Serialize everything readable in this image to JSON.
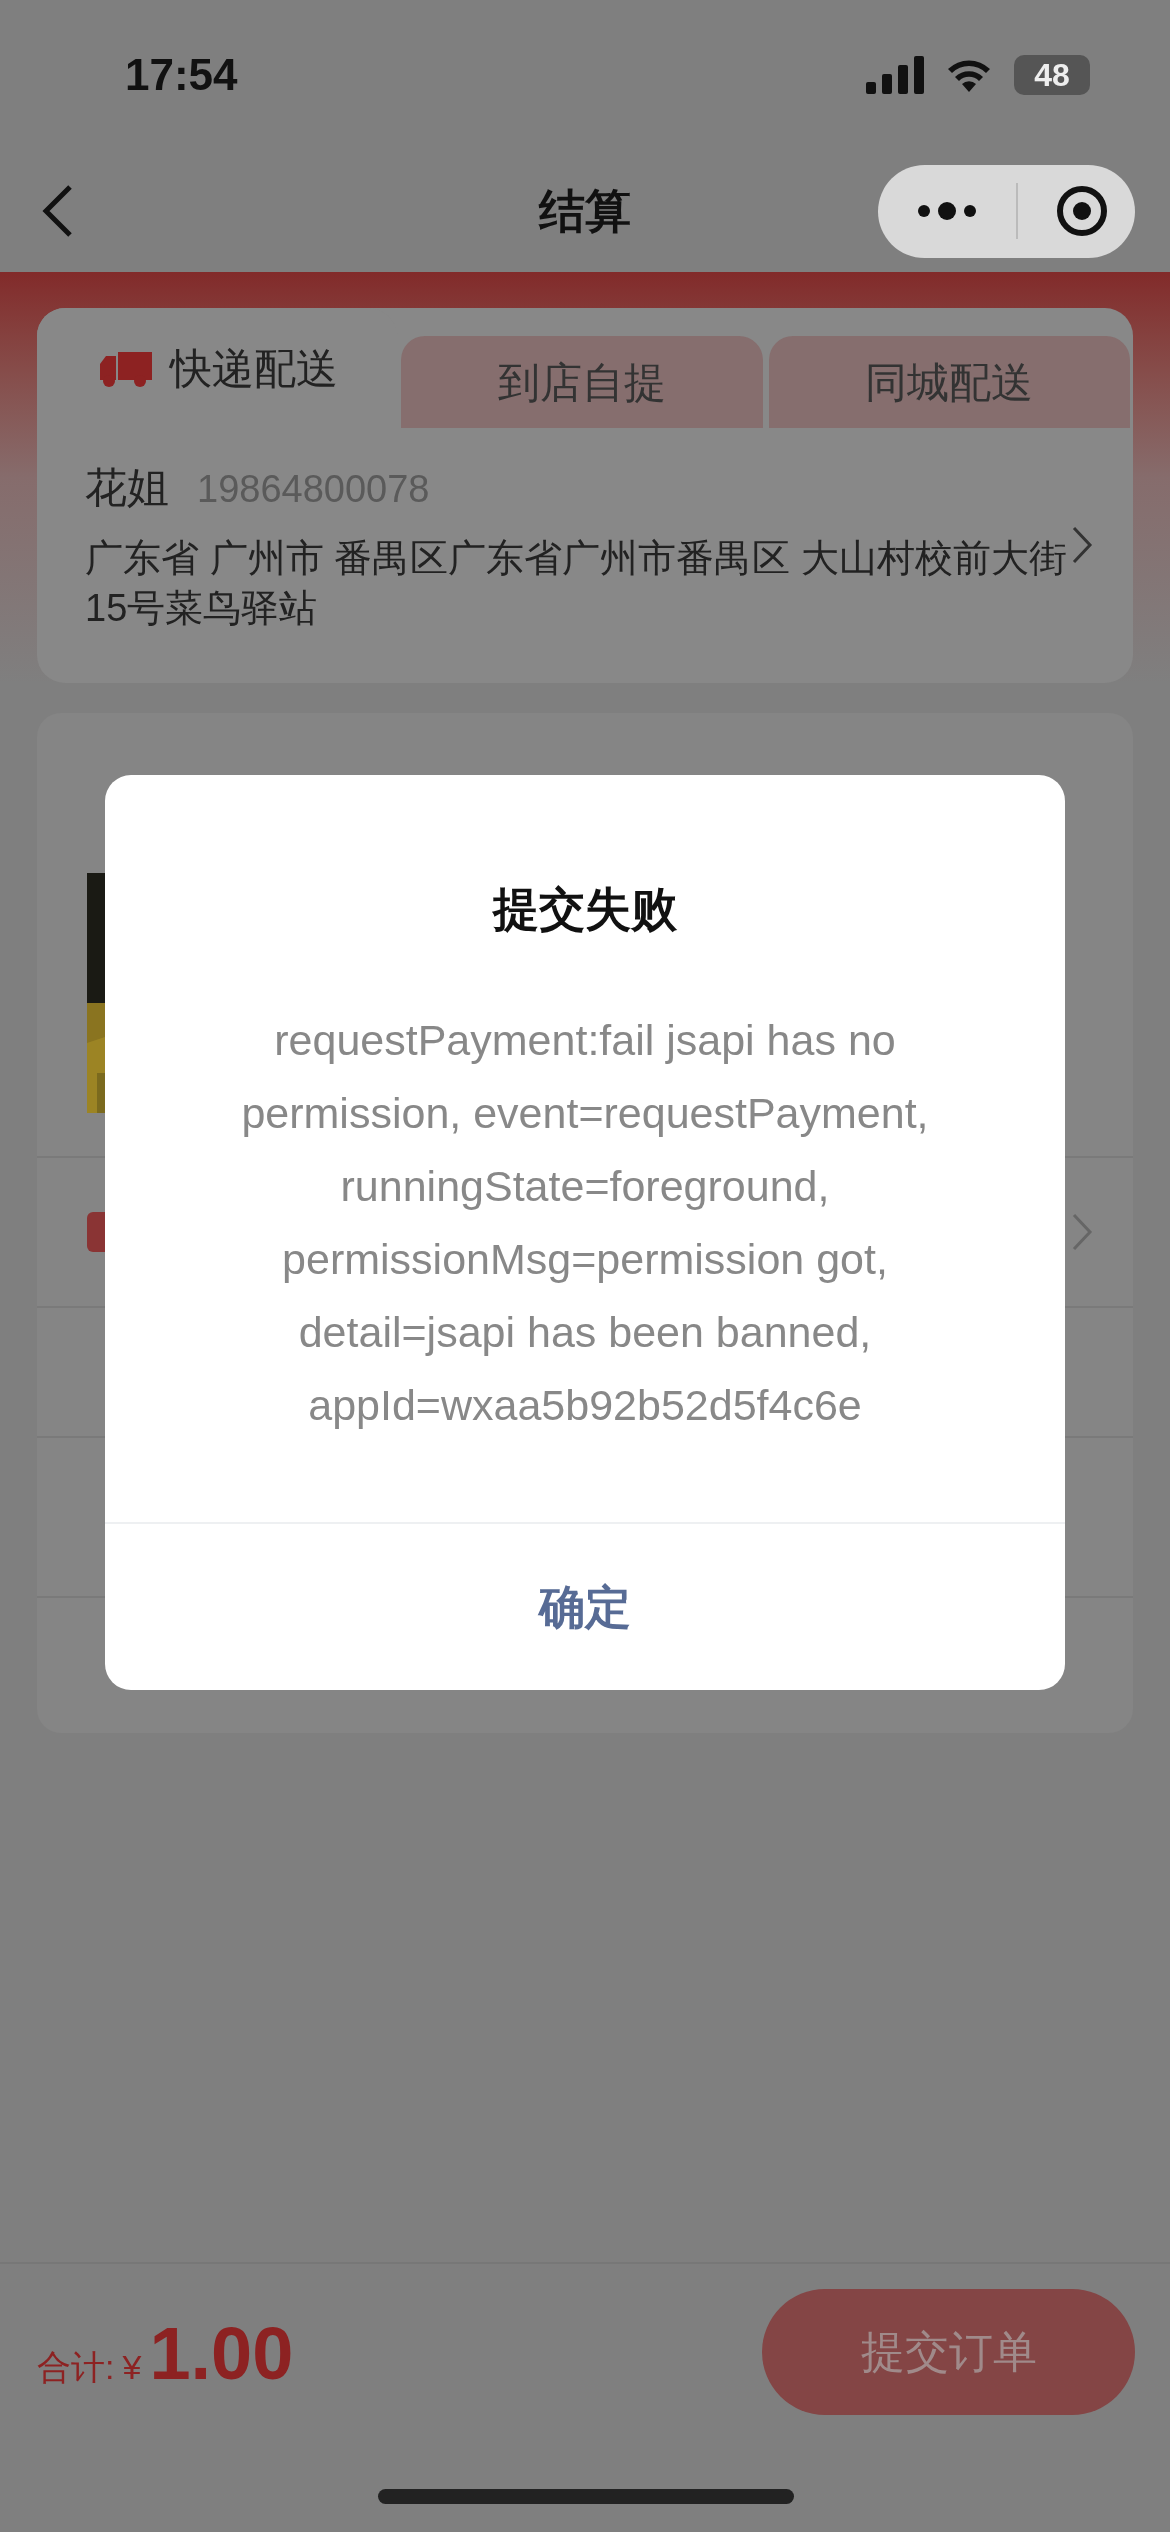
{
  "status_bar": {
    "time": "17:54",
    "battery": "48"
  },
  "nav_bar": {
    "title": "结算"
  },
  "delivery_tabs": [
    {
      "label": "快递配送",
      "selected": true
    },
    {
      "label": "到店自提",
      "selected": false
    },
    {
      "label": "同城配送",
      "selected": false
    }
  ],
  "address": {
    "name": "花姐",
    "phone": "19864800078",
    "text": "广东省 广州市 番禺区广东省广州市番禺区 大山村校前大街15号菜鸟驿站"
  },
  "dialog": {
    "title": "提交失败",
    "message": "requestPayment:fail jsapi has no permission, event=requestPayment, runningState=foreground, permissionMsg=permission got, detail=jsapi has been banned, appId=wxaa5b92b52d5f4c6e",
    "button": "确定"
  },
  "footer": {
    "total_label": "合计:",
    "currency": "¥",
    "amount": "1.00",
    "submit": "提交订单"
  }
}
